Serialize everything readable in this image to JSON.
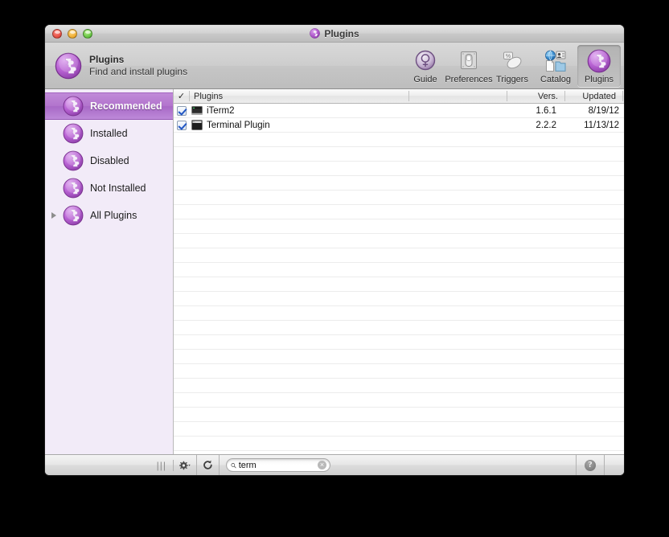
{
  "window": {
    "title": "Plugins",
    "traffic_lights": [
      "close",
      "minimize",
      "zoom"
    ]
  },
  "toolbar": {
    "heading": "Plugins",
    "subheading": "Find and install plugins",
    "buttons": [
      {
        "label": "Guide",
        "icon": "guide-icon",
        "active": false
      },
      {
        "label": "Preferences",
        "icon": "preferences-icon",
        "active": false
      },
      {
        "label": "Triggers",
        "icon": "triggers-icon",
        "active": false
      },
      {
        "label": "Catalog",
        "icon": "catalog-icon",
        "active": false
      },
      {
        "label": "Plugins",
        "icon": "plugins-icon",
        "active": true
      }
    ]
  },
  "sidebar": {
    "items": [
      {
        "label": "Recommended",
        "selected": true,
        "disclosure": false
      },
      {
        "label": "Installed",
        "selected": false,
        "disclosure": false
      },
      {
        "label": "Disabled",
        "selected": false,
        "disclosure": false
      },
      {
        "label": "Not Installed",
        "selected": false,
        "disclosure": false
      },
      {
        "label": "All Plugins",
        "selected": false,
        "disclosure": true
      }
    ]
  },
  "table": {
    "headers": {
      "check": "✓",
      "name": "Plugins",
      "version": "Vers.",
      "updated": "Updated"
    },
    "rows": [
      {
        "checked": true,
        "icon": "iterm2-terminal-icon",
        "name": "iTerm2",
        "version": "1.6.1",
        "updated": "8/19/12"
      },
      {
        "checked": true,
        "icon": "terminal-plugin-icon",
        "name": "Terminal Plugin",
        "version": "2.2.2",
        "updated": "11/13/12"
      }
    ],
    "empty_row_count": 23
  },
  "bottombar": {
    "resize_grip": "|||",
    "action_gear": "gear-icon",
    "refresh": "refresh-icon",
    "search": {
      "value": "term",
      "placeholder": "Search",
      "clear_label": "×"
    },
    "help": "?"
  },
  "colors": {
    "accent_purple": "#a868c6",
    "sidebar_bg": "#f2ebf8",
    "toolbar_bg": "#cdcdcd",
    "selection_text": "#ffffff"
  }
}
